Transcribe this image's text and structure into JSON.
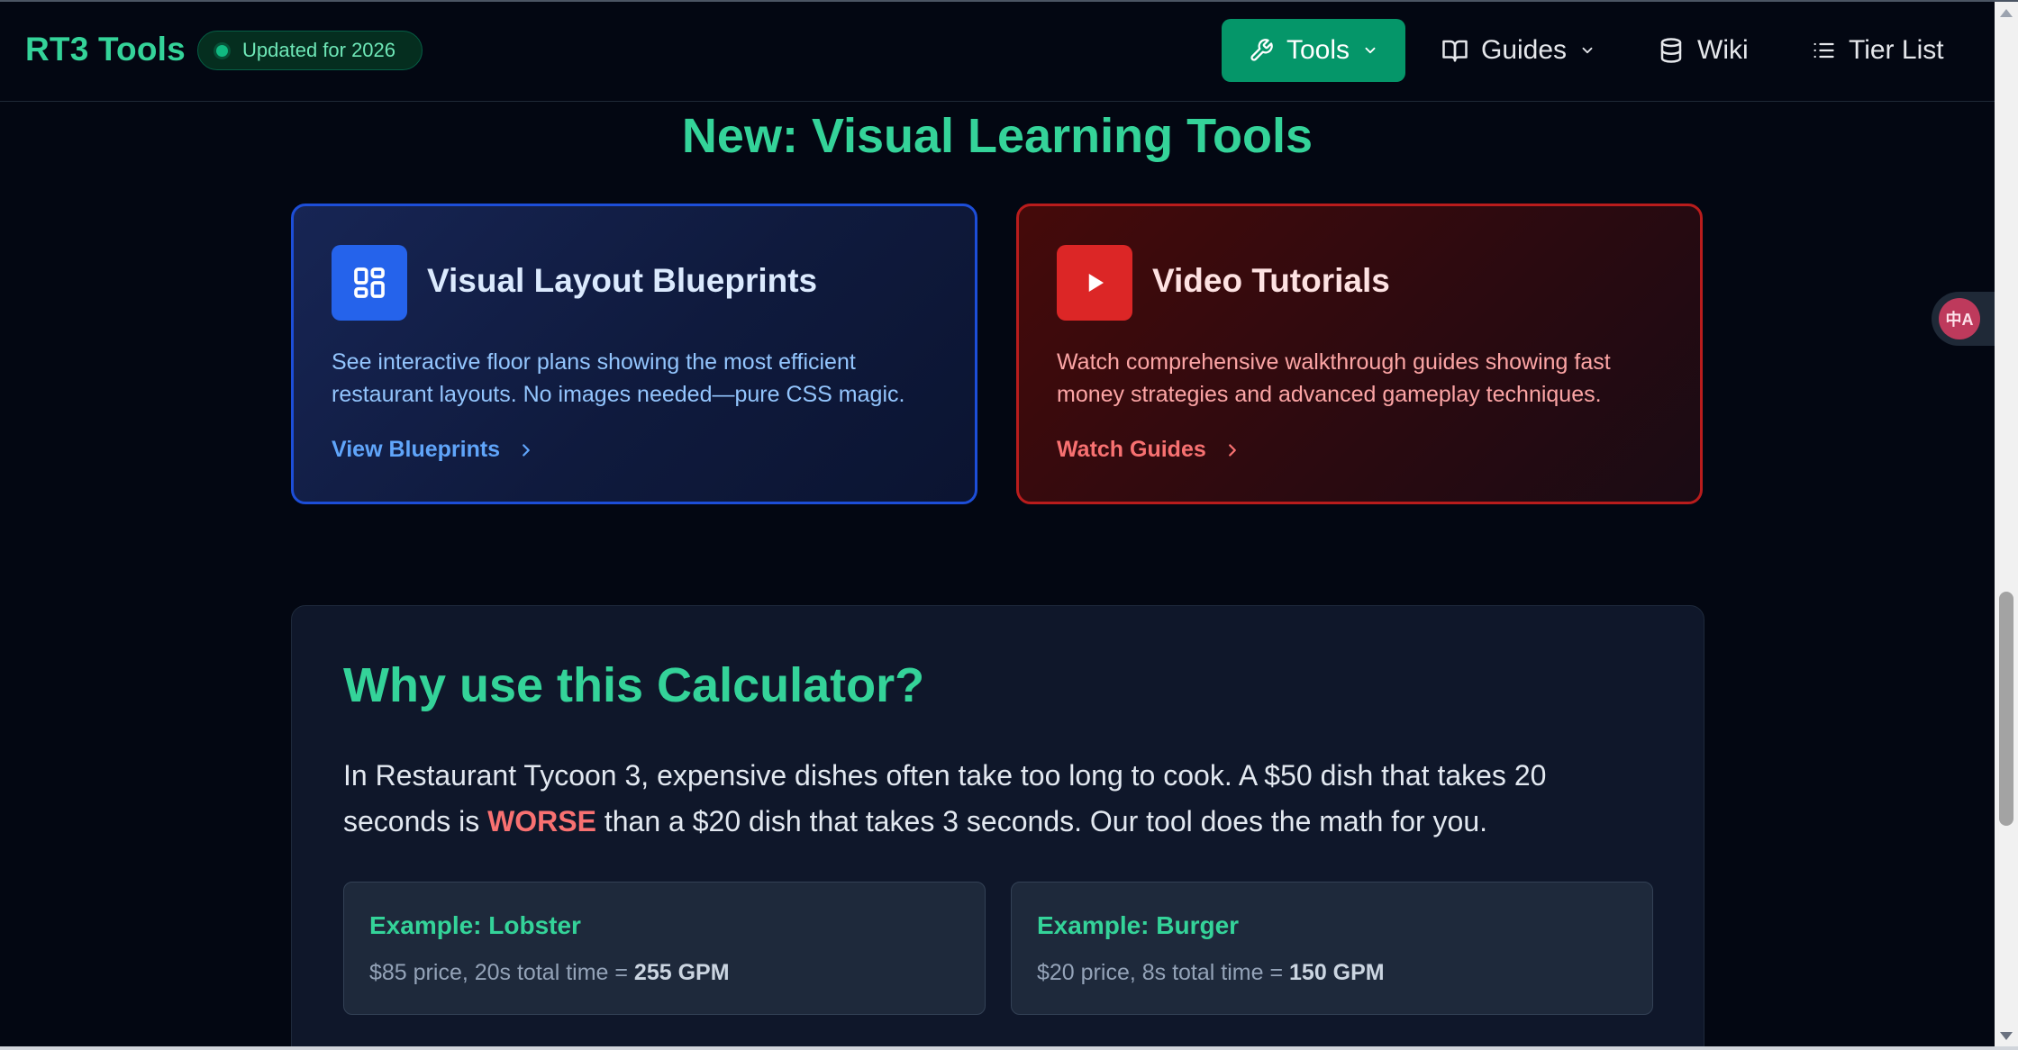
{
  "header": {
    "brand": "RT3 Tools",
    "badge": "Updated for 2026",
    "nav": {
      "tools": "Tools",
      "guides": "Guides",
      "wiki": "Wiki",
      "tier_list": "Tier List"
    }
  },
  "section_title": "New: Visual Learning Tools",
  "cards": [
    {
      "title": "Visual Layout Blueprints",
      "description": "See interactive floor plans showing the most efficient restaurant layouts. No images needed—pure CSS magic.",
      "link": "View Blueprints",
      "icon": "grid-icon"
    },
    {
      "title": "Video Tutorials",
      "description": "Watch comprehensive walkthrough guides showing fast money strategies and advanced gameplay techniques.",
      "link": "Watch Guides",
      "icon": "play-icon"
    }
  ],
  "why": {
    "title": "Why use this Calculator?",
    "text_before": "In Restaurant Tycoon 3, expensive dishes often take too long to cook. A $50 dish that takes 20 seconds is ",
    "highlight": "WORSE",
    "text_after": " than a $20 dish that takes 3 seconds. Our tool does the math for you.",
    "examples": [
      {
        "title": "Example: Lobster",
        "text": "$85 price, 20s total time = ",
        "result": "255 GPM"
      },
      {
        "title": "Example: Burger",
        "text": "$20 price, 8s total time = ",
        "result": "150 GPM"
      }
    ]
  },
  "translate_button": "中A",
  "colors": {
    "accent": "#34d399",
    "primary_button": "#059669",
    "blue_card_border": "#1d4ed8",
    "red_card_border": "#b91c1c",
    "warning": "#f87171"
  }
}
